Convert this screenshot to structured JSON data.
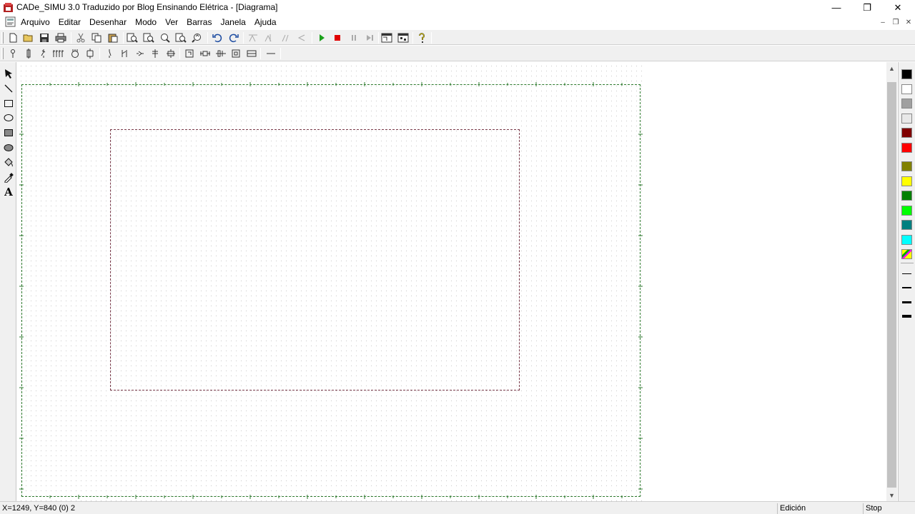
{
  "window": {
    "title": "CADe_SIMU 3.0 Traduzido por Blog Ensinando Elétrica - [Diagrama]",
    "minimize_glyph": "—",
    "restore_glyph": "❐",
    "close_glyph": "✕"
  },
  "menu": {
    "items": [
      "Arquivo",
      "Editar",
      "Desenhar",
      "Modo",
      "Ver",
      "Barras",
      "Janela",
      "Ajuda"
    ],
    "mdi_minimize": "–",
    "mdi_restore": "❐",
    "mdi_close": "✕"
  },
  "toolbar1": {
    "buttons": [
      "new-icon",
      "open-icon",
      "save-icon",
      "print-icon",
      "cut-icon",
      "copy-icon",
      "paste-icon",
      "zoom-in-icon",
      "zoom-out-icon",
      "zoom-window-icon",
      "zoom-fit-icon",
      "zoom-previous-icon",
      "undo-icon",
      "redo-icon",
      "align-top-icon",
      "align-bottom-icon",
      "align-left-icon",
      "align-right-icon",
      "run-simulation-icon",
      "stop-simulation-icon",
      "pause-simulation-icon",
      "step-simulation-icon",
      "page-view-icon",
      "component-view-icon",
      "help-icon"
    ]
  },
  "toolbar2": {
    "buttons": [
      "power-supply-icon",
      "fuse-icon",
      "breaker-icon",
      "motor-protector-icon",
      "motor-icon",
      "contactor-coil-icon",
      "switch-icon",
      "contact-icon",
      "sensor-icon",
      "pilot-light-icon",
      "relay-icon",
      "timer-relay-icon",
      "pushbutton-icon",
      "connector-icon",
      "terminal-icon",
      "wire-icon"
    ]
  },
  "left_tools": {
    "buttons": [
      "select-arrow-icon",
      "line-tool-icon",
      "rectangle-tool-icon",
      "ellipse-tool-icon",
      "filled-rectangle-tool-icon",
      "filled-ellipse-tool-icon",
      "fill-bucket-icon",
      "color-picker-icon",
      "text-tool-icon"
    ],
    "text_tool_glyph": "A"
  },
  "palette": {
    "colors": [
      "#000000",
      "#ffffff",
      "#a0a0a0",
      "#e8e8e8",
      "#800000",
      "#ff0000",
      "#808000",
      "#ffff00",
      "#008000",
      "#00ff00",
      "#008080",
      "#00ffff"
    ],
    "line_widths": [
      1,
      2,
      3,
      4
    ]
  },
  "scrollbar": {
    "up_glyph": "▲",
    "down_glyph": "▼"
  },
  "status": {
    "coords": "X=1249, Y=840 (0) 2",
    "mode": "Edición",
    "sim_state": "Stop"
  }
}
